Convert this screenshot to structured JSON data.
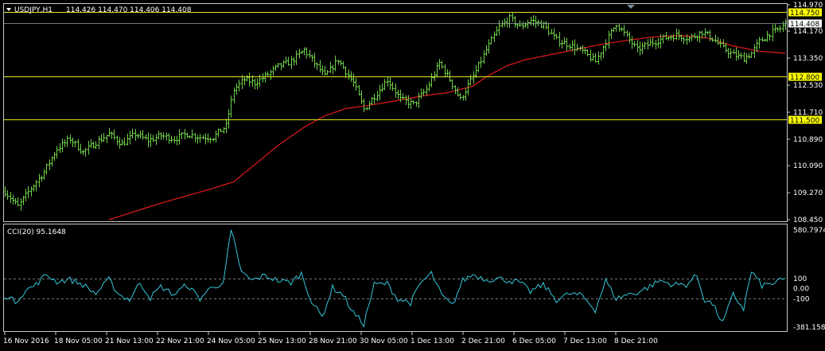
{
  "main": {
    "symbol_timeframe": "USDJPY,H1",
    "ohlc_readout": "114.426 114.470 114.406 114.408",
    "collapse_icon": "triangle-down-icon",
    "shift_marker_icon": "triangle-down-icon"
  },
  "indicator": {
    "title": "CCI(20) 95.1648"
  },
  "colors": {
    "background": "#000000",
    "bar": "#6fcf4a",
    "ma": "#e31a1a",
    "hline": "#e3e325",
    "hline_label_bg": "#ffff00",
    "cci": "#33c7d9",
    "frame": "#c8c8c8",
    "current_price_label_bg": "#ffffff"
  },
  "chart_data": [
    {
      "type": "ohlc",
      "title": "USDJPY,H1",
      "ylim": [
        108.45,
        114.97
      ],
      "y_ticks": [
        "114.970",
        "114.170",
        "113.350",
        "112.530",
        "111.710",
        "110.890",
        "110.090",
        "109.270",
        "108.450"
      ],
      "x_ticks": [
        "16 Nov 2016",
        "18 Nov 05:00",
        "21 Nov 13:00",
        "22 Nov 21:00",
        "24 Nov 05:00",
        "25 Nov 13:00",
        "28 Nov 21:00",
        "30 Nov 05:00",
        "1 Dec 13:00",
        "2 Dec 21:00",
        "6 Dec 05:00",
        "7 Dec 13:00",
        "8 Dec 21:00"
      ],
      "current_price": "114.408",
      "horizontal_lines": [
        {
          "value": 114.75,
          "label": "114.750"
        },
        {
          "value": 112.8,
          "label": "112.800"
        },
        {
          "value": 111.5,
          "label": "111.500"
        }
      ],
      "close_anchors": [
        [
          0,
          109.3
        ],
        [
          5,
          108.85
        ],
        [
          10,
          109.4
        ],
        [
          15,
          109.9
        ],
        [
          20,
          110.6
        ],
        [
          25,
          110.9
        ],
        [
          30,
          110.5
        ],
        [
          35,
          110.8
        ],
        [
          40,
          111.05
        ],
        [
          45,
          110.75
        ],
        [
          50,
          111.05
        ],
        [
          55,
          110.85
        ],
        [
          60,
          111.0
        ],
        [
          65,
          110.9
        ],
        [
          70,
          111.05
        ],
        [
          75,
          110.95
        ],
        [
          80,
          110.95
        ],
        [
          85,
          111.3
        ],
        [
          88,
          112.4
        ],
        [
          92,
          112.7
        ],
        [
          96,
          112.6
        ],
        [
          100,
          112.8
        ],
        [
          105,
          113.1
        ],
        [
          110,
          113.25
        ],
        [
          115,
          113.6
        ],
        [
          119,
          113.2
        ],
        [
          123,
          112.8
        ],
        [
          128,
          113.3
        ],
        [
          134,
          112.6
        ],
        [
          138,
          111.8
        ],
        [
          142,
          112.2
        ],
        [
          147,
          112.7
        ],
        [
          152,
          112.1
        ],
        [
          157,
          111.95
        ],
        [
          162,
          112.4
        ],
        [
          167,
          113.2
        ],
        [
          171,
          112.7
        ],
        [
          175,
          112.1
        ],
        [
          180,
          112.8
        ],
        [
          185,
          113.6
        ],
        [
          190,
          114.3
        ],
        [
          194,
          114.55
        ],
        [
          198,
          114.3
        ],
        [
          202,
          114.5
        ],
        [
          207,
          114.35
        ],
        [
          212,
          113.9
        ],
        [
          217,
          113.75
        ],
        [
          222,
          113.55
        ],
        [
          227,
          113.25
        ],
        [
          231,
          113.85
        ],
        [
          235,
          114.4
        ],
        [
          239,
          114.0
        ],
        [
          243,
          113.6
        ],
        [
          248,
          113.8
        ],
        [
          253,
          113.95
        ],
        [
          258,
          114.05
        ],
        [
          263,
          113.95
        ],
        [
          268,
          114.15
        ],
        [
          272,
          113.95
        ],
        [
          276,
          113.65
        ],
        [
          280,
          113.45
        ],
        [
          284,
          113.35
        ],
        [
          287,
          113.5
        ],
        [
          290,
          113.85
        ],
        [
          294,
          114.1
        ],
        [
          298,
          114.25
        ],
        [
          300,
          114.41
        ]
      ],
      "moving_average": [
        [
          40,
          108.45
        ],
        [
          60,
          108.95
        ],
        [
          80,
          109.4
        ],
        [
          88,
          109.6
        ],
        [
          95,
          110.05
        ],
        [
          105,
          110.7
        ],
        [
          115,
          111.25
        ],
        [
          123,
          111.6
        ],
        [
          131,
          111.82
        ],
        [
          140,
          111.92
        ],
        [
          150,
          112.05
        ],
        [
          160,
          112.2
        ],
        [
          170,
          112.3
        ],
        [
          180,
          112.5
        ],
        [
          185,
          112.78
        ],
        [
          193,
          113.12
        ],
        [
          200,
          113.3
        ],
        [
          210,
          113.46
        ],
        [
          220,
          113.62
        ],
        [
          230,
          113.78
        ],
        [
          240,
          113.9
        ],
        [
          250,
          114.0
        ],
        [
          260,
          114.04
        ],
        [
          270,
          113.96
        ],
        [
          280,
          113.72
        ],
        [
          290,
          113.56
        ],
        [
          300,
          113.5
        ]
      ]
    },
    {
      "type": "line",
      "title": "CCI(20) 95.1648",
      "ylim": [
        -381.1584,
        580.7974
      ],
      "y_ticks": [
        "580.7974",
        "100",
        "0.00",
        "-100",
        "-381.1584"
      ],
      "levels": [
        100,
        -100
      ],
      "anchors": [
        [
          0,
          -60
        ],
        [
          4,
          -130
        ],
        [
          8,
          -20
        ],
        [
          12,
          40
        ],
        [
          16,
          140
        ],
        [
          20,
          70
        ],
        [
          25,
          90
        ],
        [
          30,
          40
        ],
        [
          35,
          -50
        ],
        [
          40,
          90
        ],
        [
          44,
          -60
        ],
        [
          48,
          -110
        ],
        [
          52,
          60
        ],
        [
          56,
          -90
        ],
        [
          60,
          20
        ],
        [
          65,
          -60
        ],
        [
          70,
          40
        ],
        [
          75,
          -100
        ],
        [
          80,
          30
        ],
        [
          84,
          40
        ],
        [
          87,
          590
        ],
        [
          91,
          160
        ],
        [
          95,
          80
        ],
        [
          100,
          130
        ],
        [
          105,
          80
        ],
        [
          110,
          60
        ],
        [
          114,
          150
        ],
        [
          118,
          -130
        ],
        [
          122,
          -280
        ],
        [
          126,
          10
        ],
        [
          130,
          -60
        ],
        [
          134,
          -240
        ],
        [
          138,
          -350
        ],
        [
          142,
          40
        ],
        [
          147,
          50
        ],
        [
          151,
          -100
        ],
        [
          156,
          -140
        ],
        [
          160,
          60
        ],
        [
          164,
          150
        ],
        [
          168,
          -70
        ],
        [
          172,
          -170
        ],
        [
          176,
          80
        ],
        [
          180,
          140
        ],
        [
          185,
          90
        ],
        [
          190,
          100
        ],
        [
          194,
          80
        ],
        [
          198,
          60
        ],
        [
          202,
          -30
        ],
        [
          207,
          40
        ],
        [
          212,
          -110
        ],
        [
          217,
          -50
        ],
        [
          222,
          -70
        ],
        [
          227,
          -210
        ],
        [
          231,
          80
        ],
        [
          235,
          -100
        ],
        [
          239,
          -60
        ],
        [
          243,
          -40
        ],
        [
          247,
          10
        ],
        [
          252,
          80
        ],
        [
          257,
          40
        ],
        [
          262,
          40
        ],
        [
          266,
          130
        ],
        [
          269,
          -110
        ],
        [
          272,
          -150
        ],
        [
          276,
          -340
        ],
        [
          280,
          -60
        ],
        [
          284,
          -200
        ],
        [
          287,
          170
        ],
        [
          291,
          30
        ],
        [
          295,
          50
        ],
        [
          300,
          95.1648
        ]
      ]
    }
  ]
}
